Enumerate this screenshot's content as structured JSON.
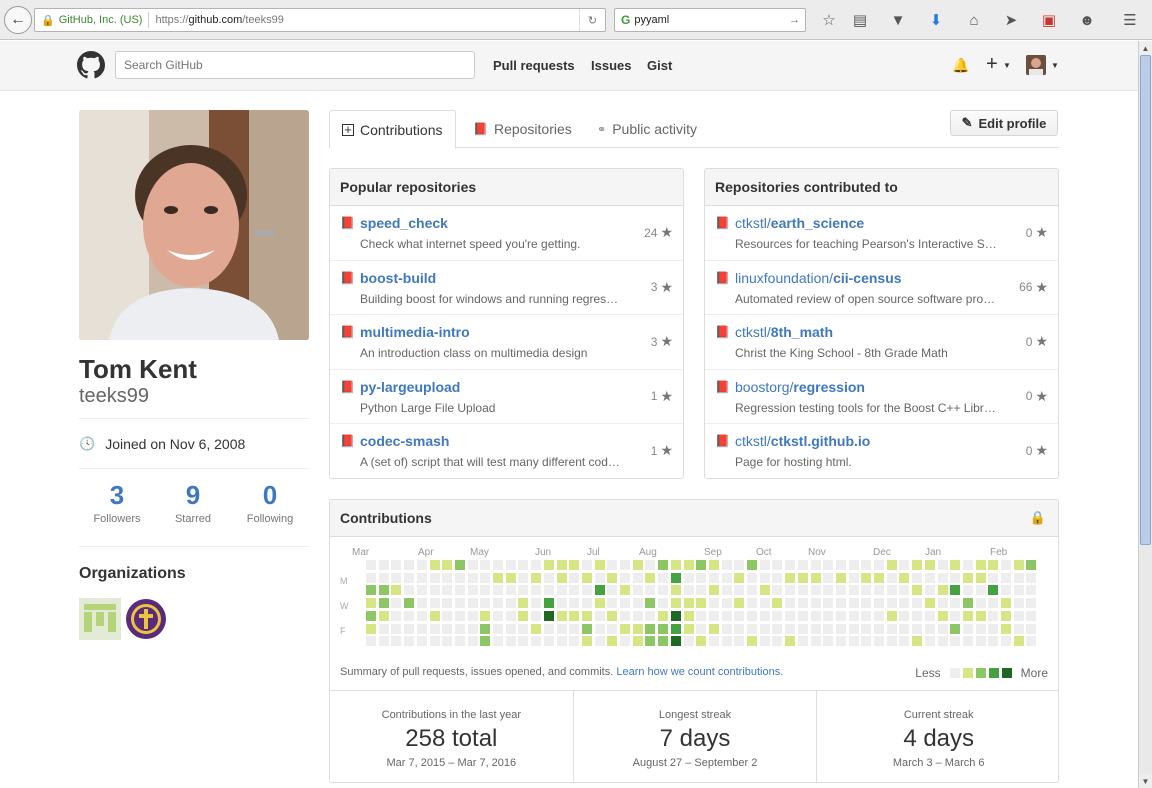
{
  "browser": {
    "site_identity": "GitHub, Inc. (US)",
    "url_prefix": "https://",
    "url_host": "github.com",
    "url_path": "/teeks99",
    "search_query": "pyyaml"
  },
  "header": {
    "search_placeholder": "Search GitHub",
    "nav": [
      "Pull requests",
      "Issues",
      "Gist"
    ]
  },
  "profile": {
    "full_name": "Tom Kent",
    "username": "teeks99",
    "joined": "Joined on Nov 6, 2008",
    "stats": [
      {
        "value": "3",
        "label": "Followers"
      },
      {
        "value": "9",
        "label": "Starred"
      },
      {
        "value": "0",
        "label": "Following"
      }
    ],
    "organizations_title": "Organizations"
  },
  "tabs": [
    "Contributions",
    "Repositories",
    "Public activity"
  ],
  "edit_profile_label": "Edit profile",
  "popular": {
    "title": "Popular repositories",
    "repos": [
      {
        "name": "speed_check",
        "desc": "Check what internet speed you're getting.",
        "stars": "24"
      },
      {
        "name": "boost-build",
        "desc": "Building boost for windows and running regression tests",
        "stars": "3"
      },
      {
        "name": "multimedia-intro",
        "desc": "An introduction class on multimedia design",
        "stars": "3"
      },
      {
        "name": "py-largeupload",
        "desc": "Python Large File Upload",
        "stars": "1"
      },
      {
        "name": "codec-smash",
        "desc": "A (set of) script that will test many different codecs",
        "stars": "1"
      }
    ]
  },
  "contributed": {
    "title": "Repositories contributed to",
    "repos": [
      {
        "owner": "ctkstl/",
        "name": "earth_science",
        "desc": "Resources for teaching Pearson's Interactive Science",
        "stars": "0"
      },
      {
        "owner": "linuxfoundation/",
        "name": "cii-census",
        "desc": "Automated review of open source software projects",
        "stars": "66"
      },
      {
        "owner": "ctkstl/",
        "name": "8th_math",
        "desc": "Christ the King School - 8th Grade Math",
        "stars": "0"
      },
      {
        "owner": "boostorg/",
        "name": "regression",
        "desc": "Regression testing tools for the Boost C++ Libraries",
        "stars": "0"
      },
      {
        "owner": "ctkstl/",
        "name": "ctkstl.github.io",
        "desc": "Page for hosting html.",
        "stars": "0"
      }
    ]
  },
  "contributions": {
    "title": "Contributions",
    "months": [
      "Mar",
      "Apr",
      "May",
      "Jun",
      "Jul",
      "Aug",
      "Sep",
      "Oct",
      "Nov",
      "Dec",
      "Jan",
      "Feb"
    ],
    "day_labels": [
      "M",
      "W",
      "F"
    ],
    "summary": "Summary of pull requests, issues opened, and commits.",
    "learn_link": "Learn how we count contributions.",
    "legend_less": "Less",
    "legend_more": "More",
    "colors": [
      "#eeeeee",
      "#d6e685",
      "#8cc665",
      "#44a340",
      "#1e6823"
    ],
    "streaks": [
      {
        "title": "Contributions in the last year",
        "value": "258 total",
        "range": "Mar 7, 2015 – Mar 7, 2016"
      },
      {
        "title": "Longest streak",
        "value": "7 days",
        "range": "August 27 – September 2"
      },
      {
        "title": "Current streak",
        "value": "4 days",
        "range": "March 3 – March 6"
      }
    ]
  }
}
